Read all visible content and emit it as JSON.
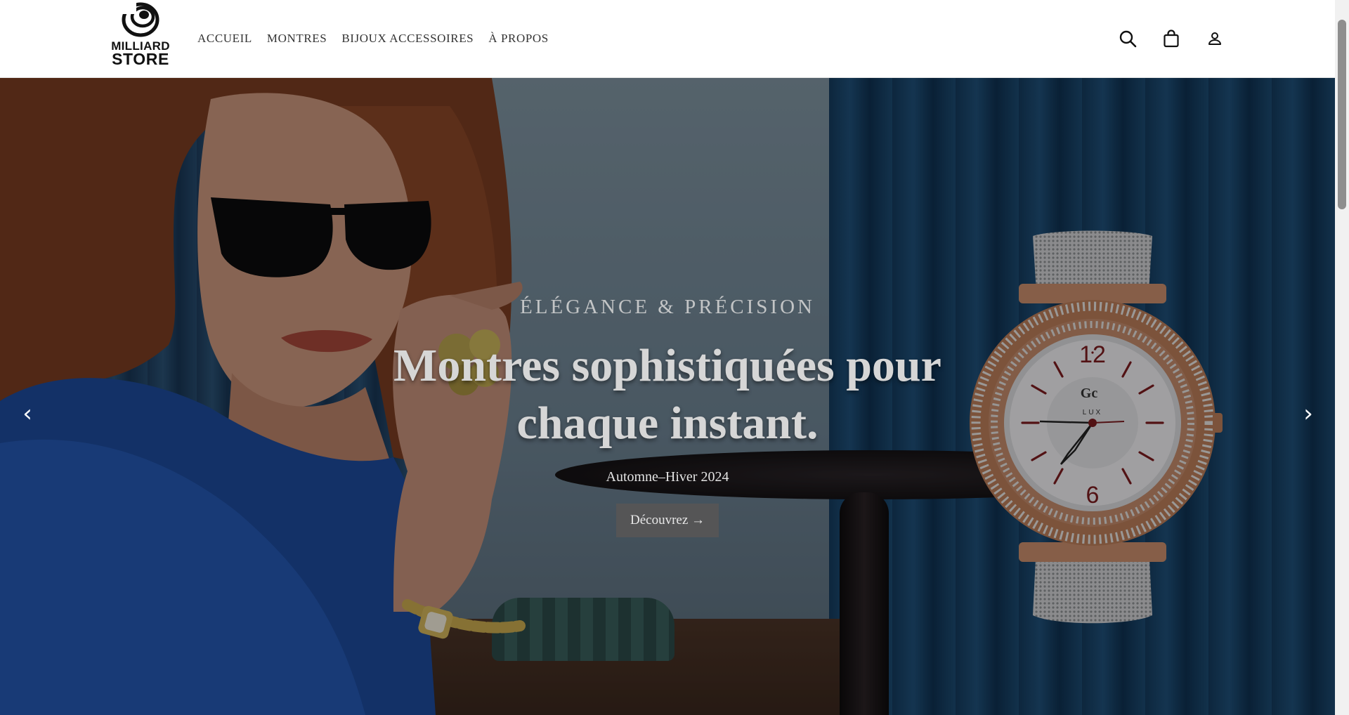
{
  "brand": {
    "line1": "MILLIARD",
    "line2": "STORE"
  },
  "nav": [
    {
      "label": "ACCUEIL"
    },
    {
      "label": "MONTRES"
    },
    {
      "label": "BIJOUX ACCESSOIRES"
    },
    {
      "label": "À PROPOS"
    }
  ],
  "header_icons": {
    "search": "search-icon",
    "cart": "shopping-bag-icon",
    "account": "user-icon"
  },
  "hero": {
    "eyebrow": "ÉLÉGANCE & PRÉCISION",
    "headline_line1": "Montres sophistiquées pour",
    "headline_line2": "chaque instant.",
    "season": "Automne–Hiver 2024",
    "cta": "Découvrez →",
    "prev_arrow": "‹",
    "next_arrow": "›"
  },
  "watch_dial": {
    "brand": "Gc",
    "model": "LUX",
    "numeral_top": "12",
    "numeral_bottom": "6"
  },
  "colors": {
    "cta_bg": "#555556",
    "header_bg": "#ffffff",
    "accent_gold": "#b8764e"
  }
}
